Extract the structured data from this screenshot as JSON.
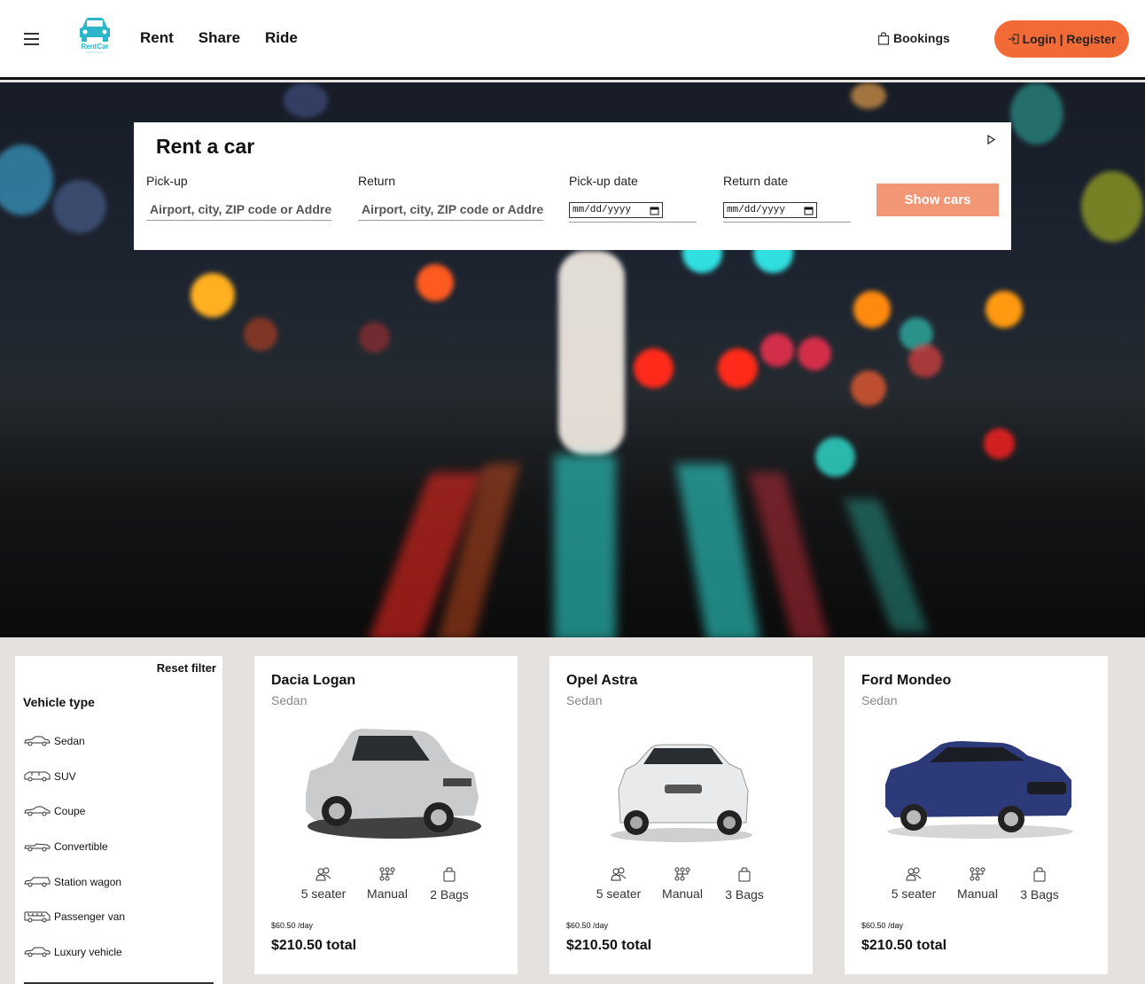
{
  "header": {
    "logo": {
      "name": "RentCar",
      "tagline": "rental company"
    },
    "nav": [
      "Rent",
      "Share",
      "Ride"
    ],
    "bookings_label": "Bookings",
    "login_label": "Login | Register",
    "accent_color": "#f26b37"
  },
  "search": {
    "title": "Rent a car",
    "pickup_label": "Pick-up",
    "pickup_placeholder": "Airport, city, ZIP code or Address",
    "return_label": "Return",
    "return_placeholder": "Airport, city, ZIP code or Address",
    "pickup_date_label": "Pick-up date",
    "pickup_date_value": "mm/dd/yyyy",
    "return_date_label": "Return date",
    "return_date_value": "mm/dd/yyyy",
    "button_label": "Show cars"
  },
  "filter": {
    "reset_label": "Reset filter",
    "title": "Vehicle type",
    "types": [
      "Sedan",
      "SUV",
      "Coupe",
      "Convertible",
      "Station wagon",
      "Passenger van",
      "Luxury vehicle"
    ]
  },
  "cars": [
    {
      "name": "Dacia Logan",
      "type": "Sedan",
      "seats": "5 seater",
      "transmission": "Manual",
      "bags": "2 Bags",
      "per_day": "$60.50 /day",
      "total": "$210.50 total",
      "color": "#c9cbcd"
    },
    {
      "name": "Opel Astra",
      "type": "Sedan",
      "seats": "5 seater",
      "transmission": "Manual",
      "bags": "3 Bags",
      "per_day": "$60.50 /day",
      "total": "$210.50 total",
      "color": "#e8eaec"
    },
    {
      "name": "Ford Mondeo",
      "type": "Sedan",
      "seats": "5 seater",
      "transmission": "Manual",
      "bags": "3 Bags",
      "per_day": "$60.50 /day",
      "total": "$210.50 total",
      "color": "#2c3a7a"
    }
  ]
}
